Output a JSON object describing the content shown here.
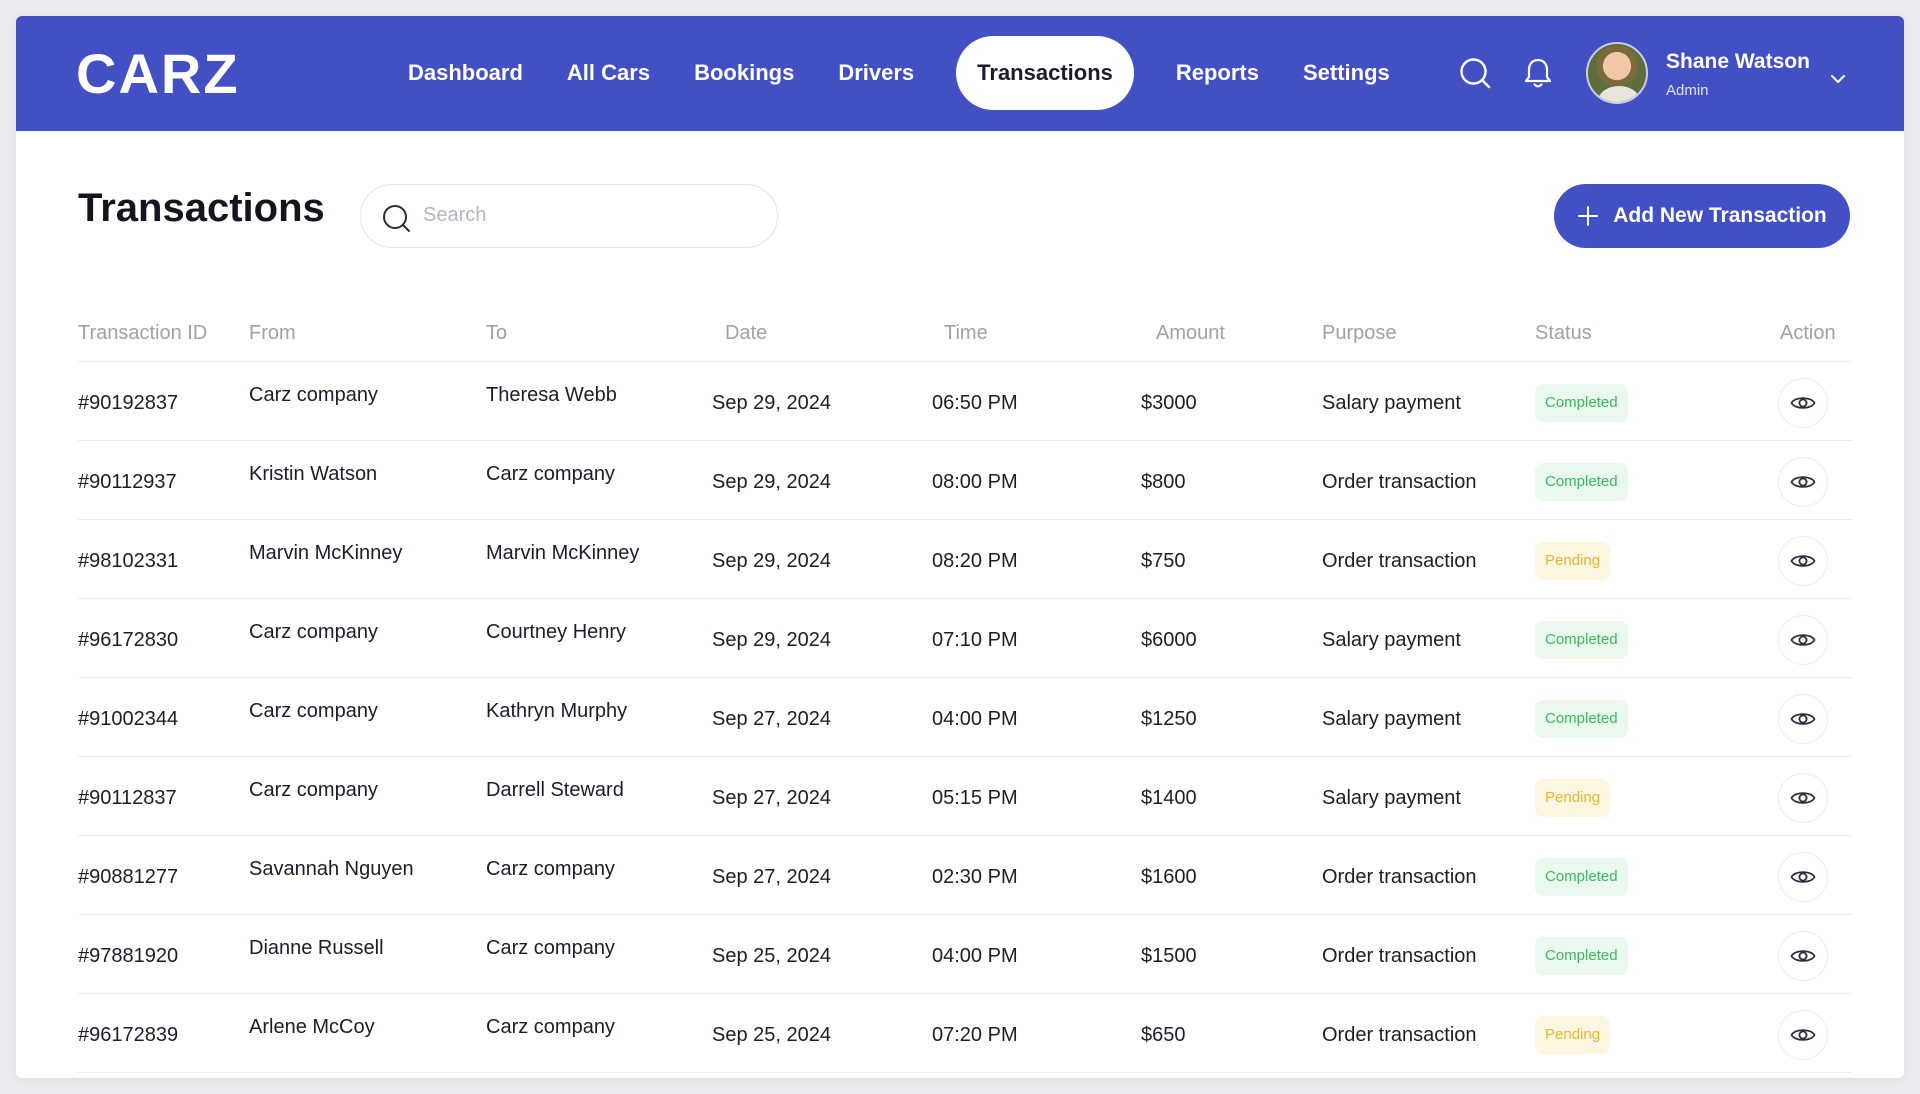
{
  "brand": {
    "logo_text": "CARZ",
    "accent_color": "#4350c4"
  },
  "nav": {
    "items": [
      {
        "label": "Dashboard",
        "active": false
      },
      {
        "label": "All Cars",
        "active": false
      },
      {
        "label": "Bookings",
        "active": false
      },
      {
        "label": "Drivers",
        "active": false
      },
      {
        "label": "Transactions",
        "active": true
      },
      {
        "label": "Reports",
        "active": false
      },
      {
        "label": "Settings",
        "active": false
      }
    ],
    "icons": [
      "search-icon",
      "bell-icon"
    ]
  },
  "user": {
    "name": "Shane Watson",
    "role": "Admin"
  },
  "page": {
    "title": "Transactions",
    "search_placeholder": "Search",
    "add_button_label": "Add New Transaction"
  },
  "table": {
    "columns": [
      "Transaction ID",
      "From",
      "To",
      "Date",
      "Time",
      "Amount",
      "Purpose",
      "Status",
      "Action"
    ],
    "rows": [
      {
        "id": "#90192837",
        "from": "Carz company",
        "to": "Theresa Webb",
        "date": "Sep 29, 2024",
        "time": "06:50 PM",
        "amount": "$3000",
        "purpose": "Salary payment",
        "status": "Completed"
      },
      {
        "id": "#90112937",
        "from": "Kristin Watson",
        "to": "Carz company",
        "date": "Sep 29, 2024",
        "time": "08:00 PM",
        "amount": "$800",
        "purpose": "Order transaction",
        "status": "Completed"
      },
      {
        "id": "#98102331",
        "from": "Marvin McKinney",
        "to": "Marvin McKinney",
        "date": "Sep 29, 2024",
        "time": "08:20 PM",
        "amount": "$750",
        "purpose": "Order transaction",
        "status": "Pending"
      },
      {
        "id": "#96172830",
        "from": "Carz company",
        "to": "Courtney Henry",
        "date": "Sep 29, 2024",
        "time": "07:10 PM",
        "amount": "$6000",
        "purpose": "Salary payment",
        "status": "Completed"
      },
      {
        "id": "#91002344",
        "from": "Carz company",
        "to": "Kathryn Murphy",
        "date": "Sep 27, 2024",
        "time": "04:00 PM",
        "amount": "$1250",
        "purpose": "Salary payment",
        "status": "Completed"
      },
      {
        "id": "#90112837",
        "from": "Carz company",
        "to": "Darrell Steward",
        "date": "Sep 27, 2024",
        "time": "05:15 PM",
        "amount": "$1400",
        "purpose": "Salary payment",
        "status": "Pending"
      },
      {
        "id": "#90881277",
        "from": "Savannah Nguyen",
        "to": "Carz company",
        "date": "Sep 27, 2024",
        "time": "02:30 PM",
        "amount": "$1600",
        "purpose": "Order transaction",
        "status": "Completed"
      },
      {
        "id": "#97881920",
        "from": "Dianne Russell",
        "to": "Carz company",
        "date": "Sep 25, 2024",
        "time": "04:00 PM",
        "amount": "$1500",
        "purpose": "Order transaction",
        "status": "Completed"
      },
      {
        "id": "#96172839",
        "from": "Arlene McCoy",
        "to": "Carz company",
        "date": "Sep 25, 2024",
        "time": "07:20 PM",
        "amount": "$650",
        "purpose": "Order transaction",
        "status": "Pending"
      }
    ]
  },
  "colors": {
    "status_completed": "#3cb85e",
    "status_pending": "#e8b62c"
  }
}
